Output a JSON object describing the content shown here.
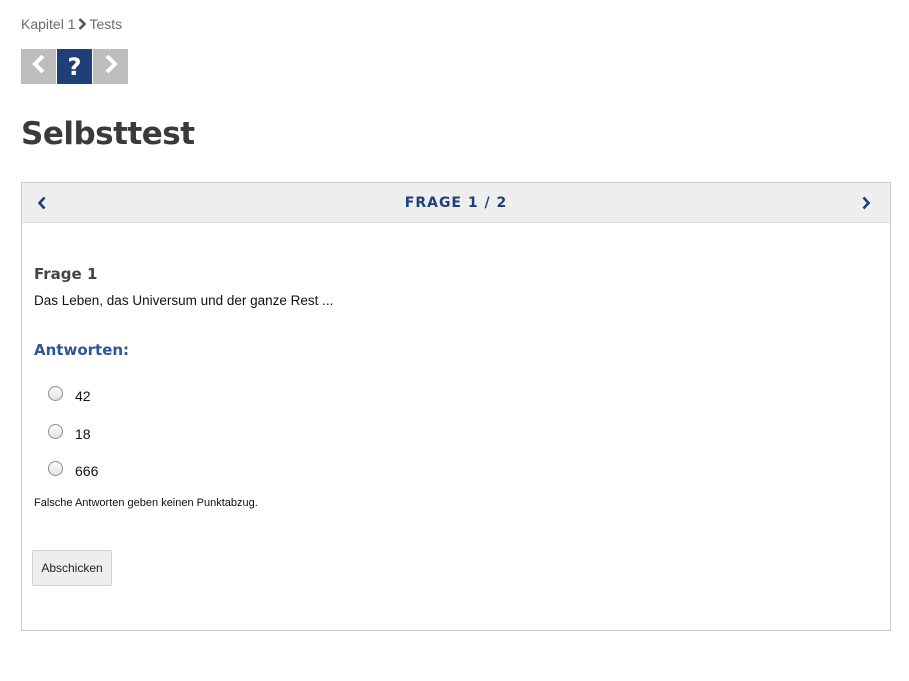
{
  "breadcrumb": {
    "items": [
      "Kapitel 1",
      "Tests"
    ],
    "separator_icon": "chevron-right-icon"
  },
  "nav": {
    "prev_icon": "chevron-left-icon",
    "help_label": "?",
    "next_icon": "chevron-right-icon",
    "active_color": "#1f3f79",
    "inactive_color": "#bdbdbd"
  },
  "page": {
    "title": "Selbsttest"
  },
  "quiz": {
    "counter": "FRAGE 1 / 2",
    "question_label": "Frage 1",
    "question_text": "Das Leben, das Universum und der ganze Rest ...",
    "answers_label": "Antworten:",
    "options": [
      {
        "label": "42",
        "checked": false
      },
      {
        "label": "18",
        "checked": false
      },
      {
        "label": "666",
        "checked": false
      }
    ],
    "hint": "Falsche Antworten geben keinen Punktabzug.",
    "submit_label": "Abschicken",
    "accent_color": "#1f3f79"
  }
}
